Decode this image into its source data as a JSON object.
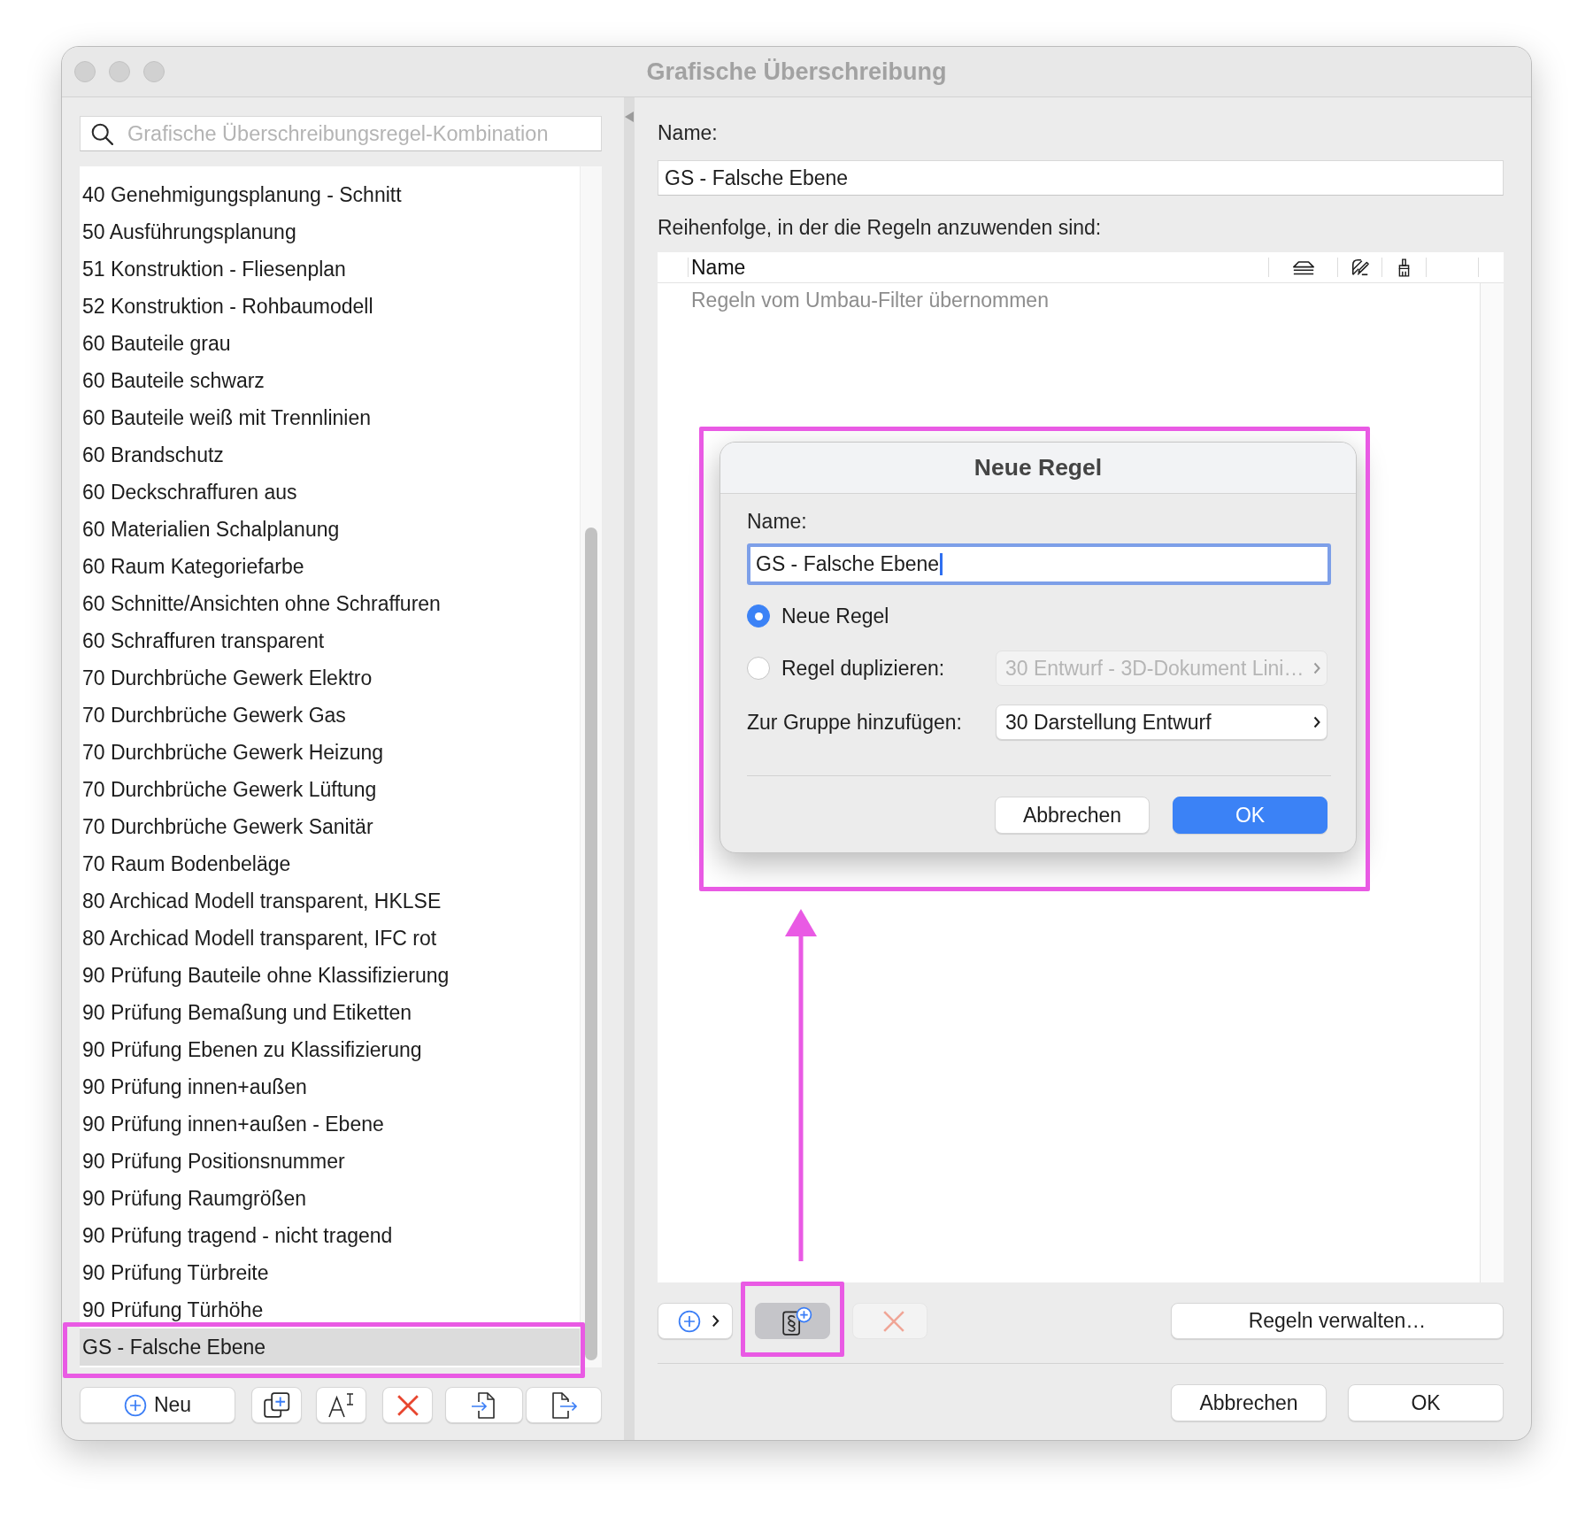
{
  "window": {
    "title": "Grafische Überschreibung"
  },
  "sidebar": {
    "search": {
      "placeholder": "Grafische Überschreibungsregel-Kombination"
    },
    "items": [
      {
        "label": "40 Genehmigungsplanung - Schnitt",
        "selected": false
      },
      {
        "label": "50 Ausführungsplanung",
        "selected": false
      },
      {
        "label": "51 Konstruktion - Fliesenplan",
        "selected": false
      },
      {
        "label": "52 Konstruktion - Rohbaumodell",
        "selected": false
      },
      {
        "label": "60 Bauteile grau",
        "selected": false
      },
      {
        "label": "60 Bauteile schwarz",
        "selected": false
      },
      {
        "label": "60 Bauteile weiß mit Trennlinien",
        "selected": false
      },
      {
        "label": "60 Brandschutz",
        "selected": false
      },
      {
        "label": "60 Deckschraffuren aus",
        "selected": false
      },
      {
        "label": "60 Materialien Schalplanung",
        "selected": false
      },
      {
        "label": "60 Raum Kategoriefarbe",
        "selected": false
      },
      {
        "label": "60 Schnitte/Ansichten ohne Schraffuren",
        "selected": false
      },
      {
        "label": "60 Schraffuren transparent",
        "selected": false
      },
      {
        "label": "70 Durchbrüche Gewerk Elektro",
        "selected": false
      },
      {
        "label": "70 Durchbrüche Gewerk Gas",
        "selected": false
      },
      {
        "label": "70 Durchbrüche Gewerk Heizung",
        "selected": false
      },
      {
        "label": "70 Durchbrüche Gewerk Lüftung",
        "selected": false
      },
      {
        "label": "70 Durchbrüche Gewerk Sanitär",
        "selected": false
      },
      {
        "label": "70 Raum Bodenbeläge",
        "selected": false
      },
      {
        "label": "80 Archicad Modell transparent, HKLSE",
        "selected": false
      },
      {
        "label": "80 Archicad Modell transparent, IFC rot",
        "selected": false
      },
      {
        "label": "90 Prüfung Bauteile ohne Klassifizierung",
        "selected": false
      },
      {
        "label": "90 Prüfung Bemaßung und Etiketten",
        "selected": false
      },
      {
        "label": "90 Prüfung Ebenen zu Klassifizierung",
        "selected": false
      },
      {
        "label": "90 Prüfung innen+außen",
        "selected": false
      },
      {
        "label": "90 Prüfung innen+außen - Ebene",
        "selected": false
      },
      {
        "label": "90 Prüfung Positionsnummer",
        "selected": false
      },
      {
        "label": "90 Prüfung Raumgrößen",
        "selected": false
      },
      {
        "label": "90 Prüfung tragend - nicht tragend",
        "selected": false
      },
      {
        "label": "90 Prüfung Türbreite",
        "selected": false
      },
      {
        "label": "90 Prüfung Türhöhe",
        "selected": false
      },
      {
        "label": "GS - Falsche Ebene",
        "selected": true
      }
    ],
    "toolbar": [
      {
        "kind": "add",
        "label": "Neu"
      },
      {
        "kind": "duplicate"
      },
      {
        "kind": "rename"
      },
      {
        "kind": "delete"
      },
      {
        "kind": "import"
      },
      {
        "kind": "export"
      }
    ]
  },
  "detail": {
    "name_label": "Name:",
    "name_value": "GS - Falsche Ebene",
    "order_label": "Reihenfolge, in der die Regeln anzuwenden sind:",
    "table": {
      "columns": [
        {
          "kind": "text",
          "label": "Name"
        },
        {
          "kind": "surface"
        },
        {
          "kind": "hatch"
        },
        {
          "kind": "brush"
        }
      ],
      "rows": [
        {
          "kind": "inherited",
          "label": "Regeln vom Umbau-Filter übernommen"
        }
      ]
    },
    "rule_toolbar": [
      {
        "kind": "add-menu",
        "pressed": false,
        "disabled": false
      },
      {
        "kind": "add-paragraph",
        "pressed": true,
        "disabled": false
      },
      {
        "kind": "delete",
        "pressed": false,
        "disabled": true
      }
    ],
    "manage_button": "Regeln verwalten…"
  },
  "footer_buttons": [
    "Abbrechen",
    "OK"
  ],
  "dialog": {
    "title": "Neue Regel",
    "name_label": "Name:",
    "name_value": "GS - Falsche Ebene",
    "focused": true,
    "options": [
      {
        "label": "Neue Regel",
        "selected": true
      },
      {
        "label": "Regel duplizieren:",
        "selected": false,
        "popup": {
          "value": "30 Entwurf - 3D-Dokument Lini…",
          "disabled": true
        }
      }
    ],
    "group_label": "Zur Gruppe hinzufügen:",
    "group_popup": {
      "value": "30 Darstellung Entwurf",
      "disabled": false
    },
    "buttons": [
      {
        "label": "Abbrechen",
        "default": false
      },
      {
        "label": "OK",
        "default": true
      }
    ]
  },
  "annotations": {
    "frame_selected_item": true,
    "frame_pressed_tool": true,
    "frame_dialog": true,
    "arrow_to_dialog": true
  }
}
